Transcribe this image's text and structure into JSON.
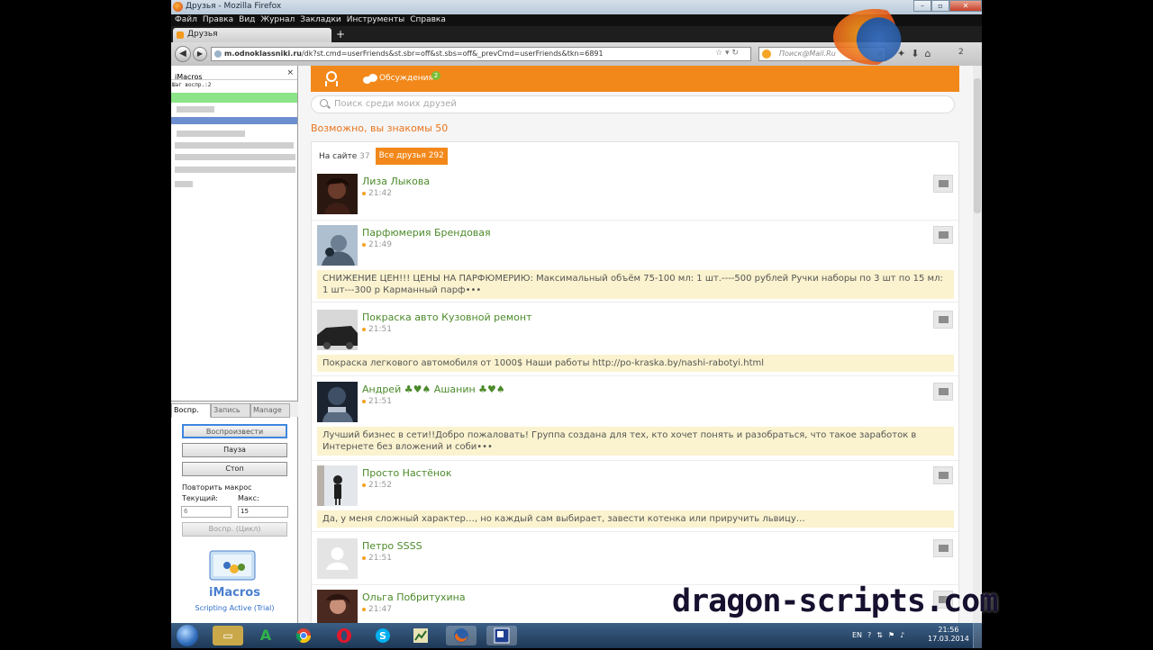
{
  "window": {
    "title": "Друзья - Mozilla Firefox",
    "controls": [
      "–",
      "▫",
      "✕"
    ]
  },
  "menu": [
    "Файл",
    "Правка",
    "Вид",
    "Журнал",
    "Закладки",
    "Инструменты",
    "Справка"
  ],
  "tab": {
    "title": "Друзья",
    "new_tab": "+"
  },
  "nav": {
    "back": "◀",
    "forward": "▶",
    "url_host": "m.odnoklassniki.ru",
    "url_path": "/dk?st.cmd=userFriends&st.sbr=off&st.sbs=off&_prevCmd=userFriends&tkn=6891",
    "search_placeholder": "Поиск@Mail.Ru",
    "badge": "2"
  },
  "imacros": {
    "title": "iMacros",
    "close": "×",
    "step_label": "Шаг воспр.:2",
    "tabs": [
      "Воспр.",
      "Запись",
      "Manage"
    ],
    "buttons": {
      "play": "Воспроизвести",
      "pause": "Пауза",
      "stop": "Стоп",
      "loop": "Воспр. (Цикл)"
    },
    "repeat_label": "Повторить макрос",
    "current_label": "Текущий:",
    "max_label": "Макс:",
    "current_value": "6",
    "max_value": "15",
    "brand": "iMacros",
    "subtitle": "Scripting Active (Trial)"
  },
  "page": {
    "discussions_label": "Обсуждения",
    "discussions_badge": "2",
    "search_placeholder": "Поиск среди моих друзей",
    "maybe_known": "Возможно, вы знакомы 50",
    "filter_online": "На сайте",
    "filter_online_count": "37",
    "filter_all": "Все друзья 292",
    "accent": "#f2881a",
    "friend_name_color": "#4b8a2a"
  },
  "friends": [
    {
      "name": "Лиза Лыкова",
      "time": "21:42",
      "status": ""
    },
    {
      "name": "Парфюмерия Брендовая",
      "time": "21:49",
      "status": "СНИЖЕНИЕ ЦЕН!!! ЦЕНЫ НА ПАРФЮМЕРИЮ: Максимальный объём 75-100 мл: 1 шт.----500 рублей Ручки наборы по 3 шт по 15 мл: 1 шт---300 р Карманный парф•••"
    },
    {
      "name": "Покраска авто Кузовной ремонт",
      "time": "21:51",
      "status": "Покраска легкового автомобиля от 1000$ Наши работы http://po-kraska.by/nashi-rabotyi.html"
    },
    {
      "name": "Андрей ♣♥♠ Ашанин ♣♥♠",
      "time": "21:51",
      "status": "Лучший бизнес в сети!!Добро пожаловать! Группа создана для тех, кто хочет понять и разобраться, что такое заработок в Интернете без вложений и соби•••"
    },
    {
      "name": "Просто Настёнок",
      "time": "21:52",
      "status": "Да, у меня сложный характер…, но каждый сам выбирает, завести котенка или приручить львицу…"
    },
    {
      "name": "Петро SSSS",
      "time": "21:51",
      "status": ""
    },
    {
      "name": "Ольга Побритухина",
      "time": "21:47",
      "status": ""
    }
  ],
  "watermark": "dragon-scripts.com",
  "taskbar": {
    "lang": "EN",
    "time": "21:56",
    "date": "17.03.2014"
  }
}
